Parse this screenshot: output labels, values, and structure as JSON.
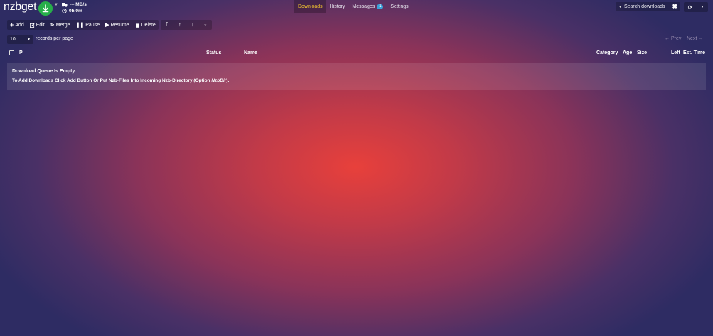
{
  "brand": {
    "logo_text": "nzbget"
  },
  "status": {
    "speed": "--- MB/s",
    "time": "0h 0m"
  },
  "tabs": [
    {
      "label": "Downloads",
      "active": true
    },
    {
      "label": "History"
    },
    {
      "label": "Messages",
      "badge": "1"
    },
    {
      "label": "Settings"
    }
  ],
  "search": {
    "placeholder": "Search downloads"
  },
  "toolbar": {
    "add": "Add",
    "edit": "Edit",
    "merge": "Merge",
    "pause": "Pause",
    "resume": "Resume",
    "delete": "Delete"
  },
  "pager": {
    "page_size": "10",
    "records_label": "records per page",
    "prev": "← Prev",
    "next": "Next →"
  },
  "table": {
    "columns": {
      "priority": "P",
      "status": "Status",
      "name": "Name",
      "category": "Category",
      "age": "Age",
      "size": "Size",
      "left": "Left",
      "est_time": "Est. Time"
    }
  },
  "empty": {
    "title": "Download Queue Is Empty.",
    "text_before": "To Add Downloads Click Add Button Or Put Nzb-Files Into Incoming Nzb-Directory (Option ",
    "option_name": "NzbDir",
    "text_after": ")."
  },
  "colors": {
    "accent_active_tab": "#f0c330",
    "badge": "#3aa0d8",
    "download_button": "#27ae4a"
  }
}
